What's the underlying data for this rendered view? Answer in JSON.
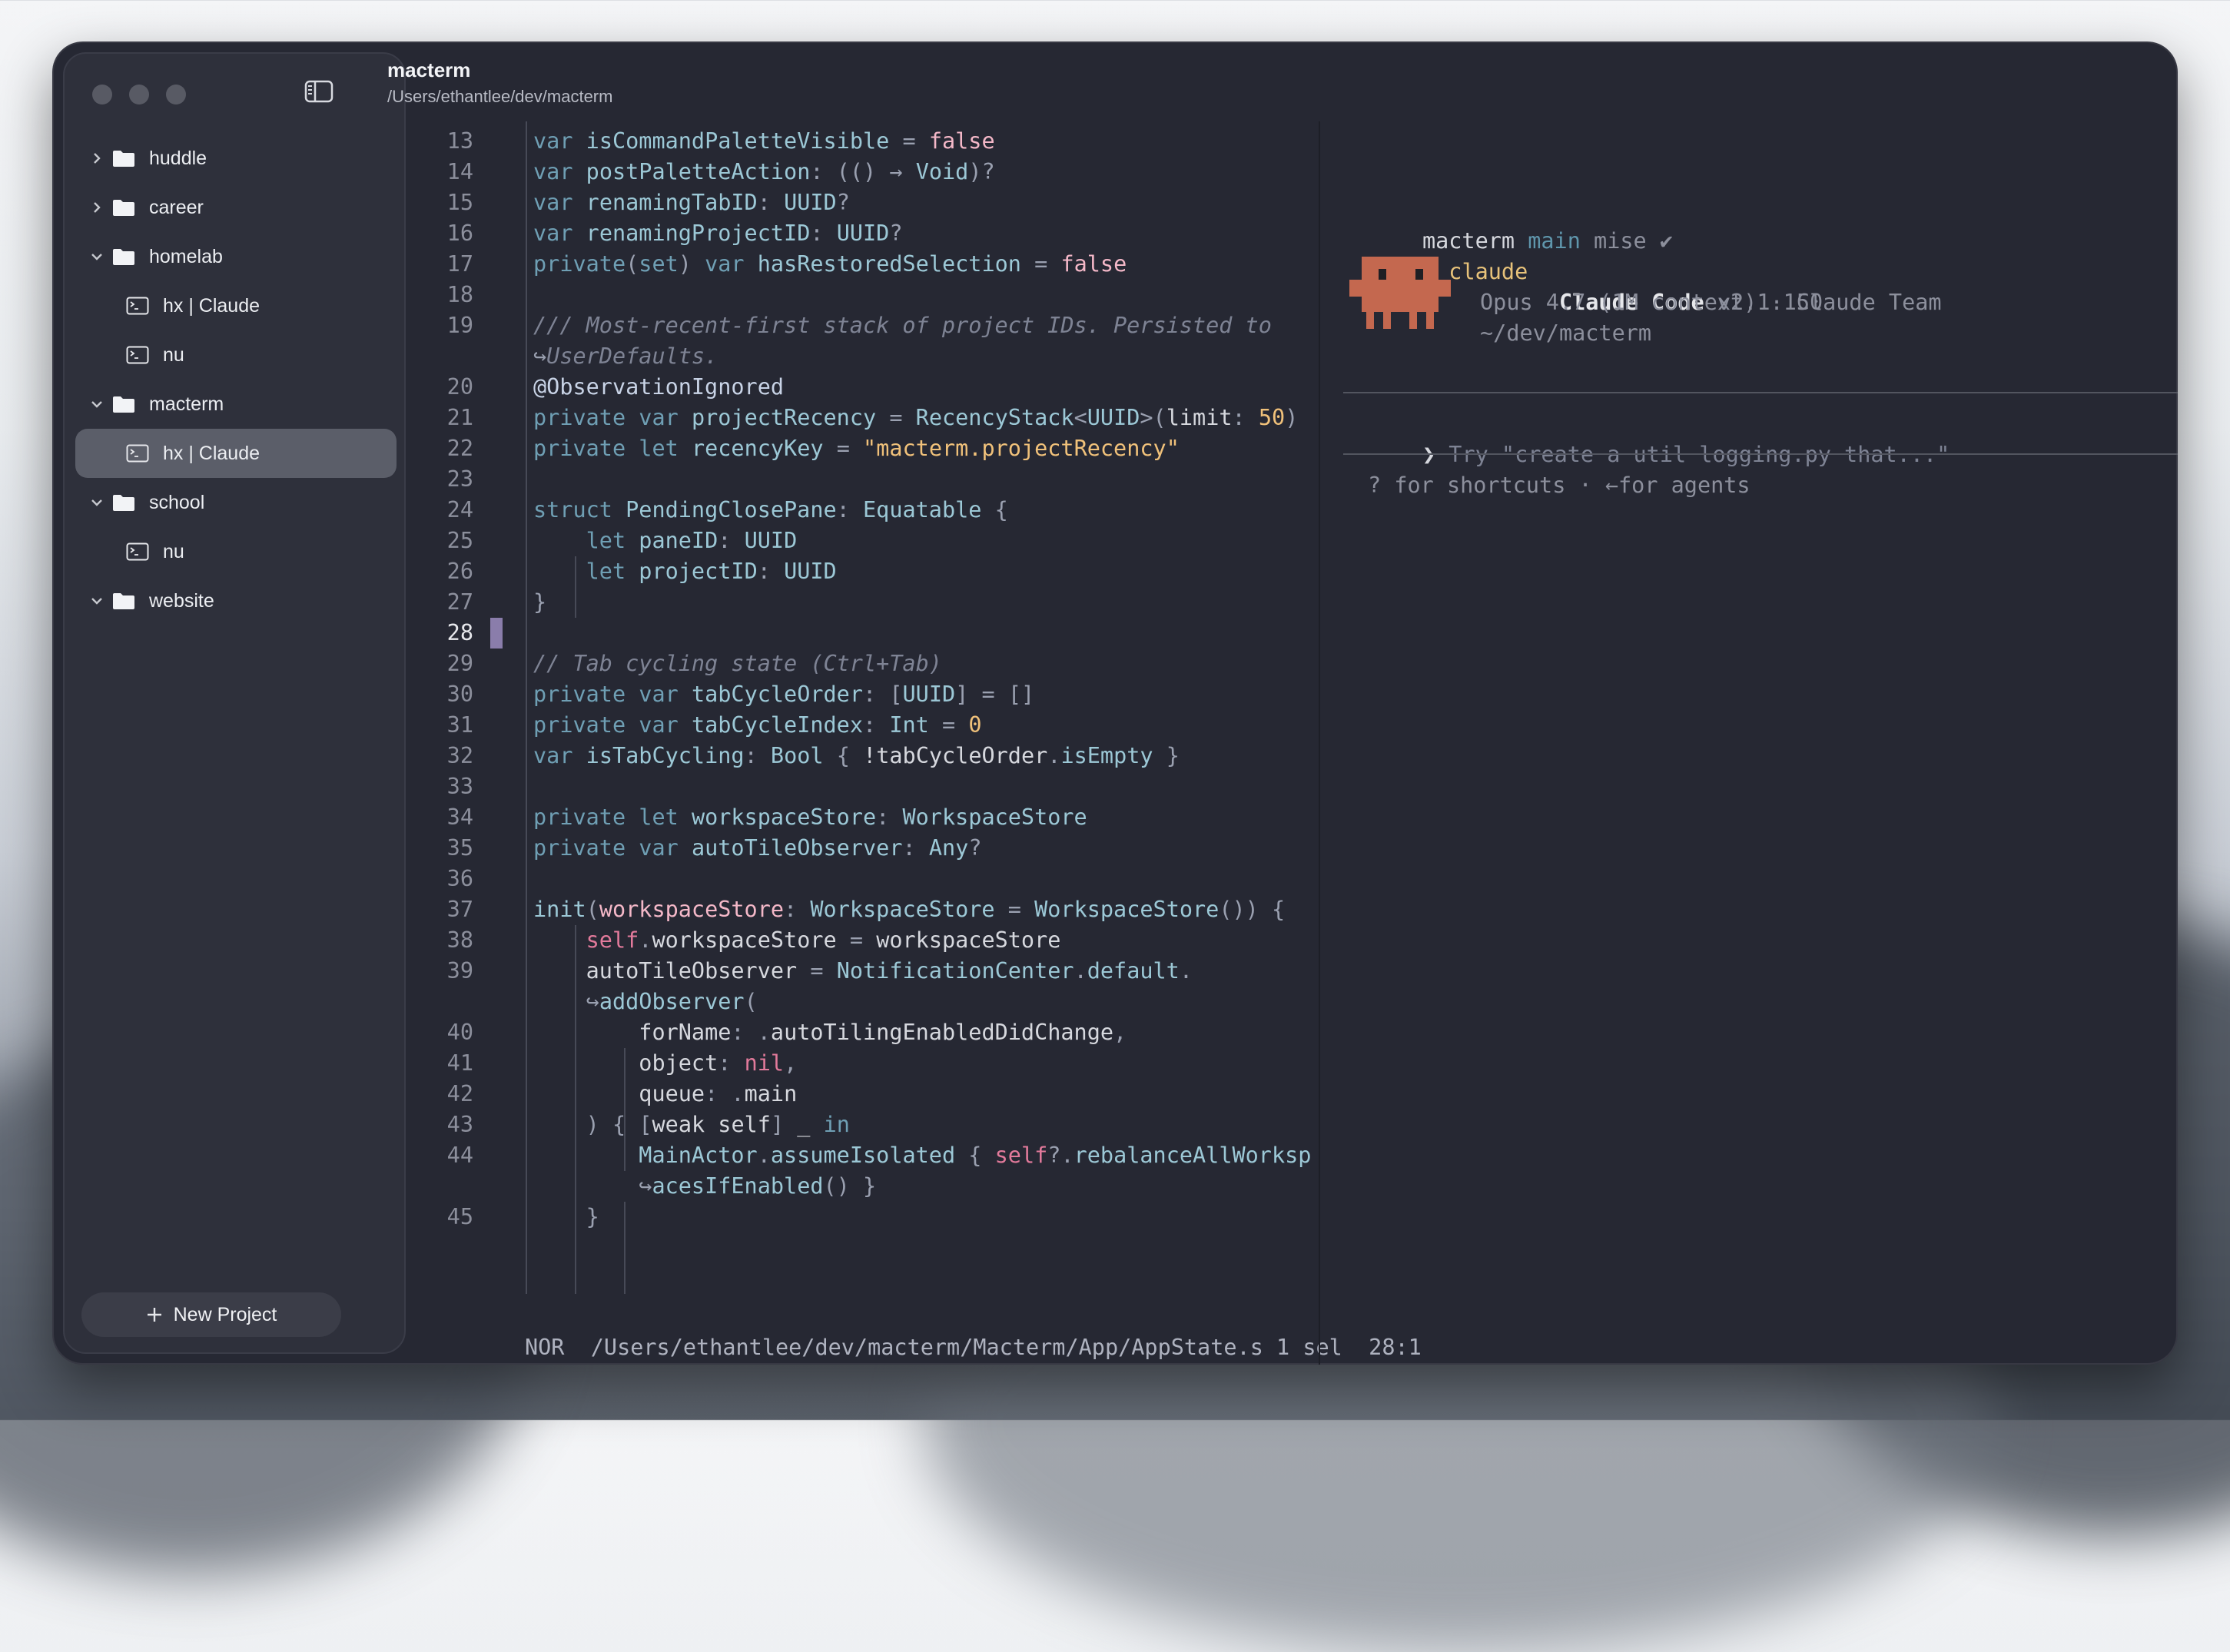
{
  "colors": {
    "accent": "#6f9fb4",
    "window_bg": "#262833",
    "sidebar_bg": "#2e303b",
    "claude_orange": "#c4684f"
  },
  "window": {
    "title": "macterm",
    "path": "/Users/ethantlee/dev/macterm"
  },
  "sidebar": {
    "items": [
      {
        "label": "huddle",
        "type": "folder",
        "expanded": false
      },
      {
        "label": "career",
        "type": "folder",
        "expanded": false
      },
      {
        "label": "homelab",
        "type": "folder",
        "expanded": true
      },
      {
        "label": "hx | Claude",
        "type": "terminal"
      },
      {
        "label": "nu",
        "type": "terminal"
      },
      {
        "label": "macterm",
        "type": "folder",
        "expanded": true
      },
      {
        "label": "hx | Claude",
        "type": "terminal",
        "selected": true
      },
      {
        "label": "school",
        "type": "folder",
        "expanded": true
      },
      {
        "label": "nu",
        "type": "terminal"
      },
      {
        "label": "website",
        "type": "folder",
        "expanded": true
      }
    ],
    "new_project_label": "New Project"
  },
  "editor": {
    "line_numbers": [
      "13",
      "14",
      "15",
      "16",
      "17",
      "18",
      "19",
      "",
      "20",
      "21",
      "22",
      "23",
      "24",
      "25",
      "26",
      "27",
      "28",
      "29",
      "30",
      "31",
      "32",
      "33",
      "34",
      "35",
      "36",
      "37",
      "38",
      "39",
      "",
      "40",
      "41",
      "42",
      "43",
      "44",
      "",
      "45"
    ],
    "status": {
      "mode": "NOR",
      "path": "/Users/ethantlee/dev/macterm/Macterm/App/AppState.s",
      "selection": "1 sel",
      "position": "28:1"
    }
  },
  "terminal": {
    "prompt_dir": "macterm",
    "prompt_branch": "main",
    "prompt_tool": "mise",
    "prompt_check": "✔",
    "command_arrow": "❯",
    "command": "claude",
    "claude_name": "Claude Code",
    "claude_version": "v2.1.150",
    "claude_model": "Opus 4.7 (1M context) · Claude Team",
    "claude_cwd": "~/dev/macterm",
    "input_arrow": "❯",
    "input_placeholder": "Try \"create a util logging.py that...\"",
    "hint": "? for shortcuts · ←for agents"
  }
}
